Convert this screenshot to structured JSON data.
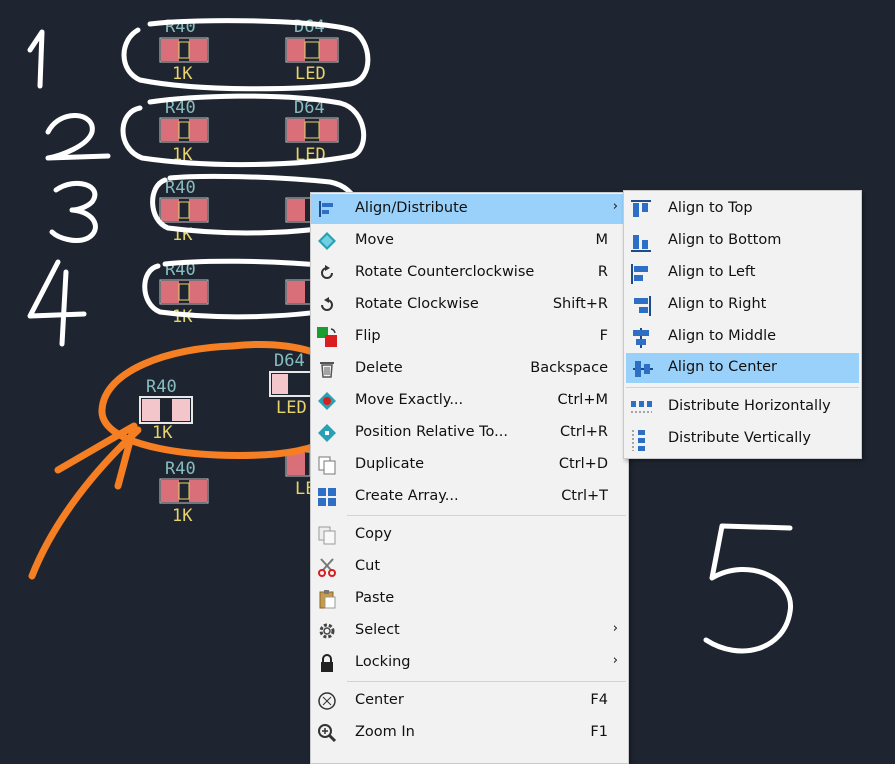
{
  "context_menu": {
    "items": [
      {
        "label": "Align/Distribute",
        "shortcut": "",
        "icon": "align-left-icon",
        "submenu": true
      },
      {
        "label": "Move",
        "shortcut": "M",
        "icon": "move-icon"
      },
      {
        "label": "Rotate Counterclockwise",
        "shortcut": "R",
        "icon": "rotate-ccw-icon"
      },
      {
        "label": "Rotate Clockwise",
        "shortcut": "Shift+R",
        "icon": "rotate-cw-icon"
      },
      {
        "label": "Flip",
        "shortcut": "F",
        "icon": "flip-icon"
      },
      {
        "label": "Delete",
        "shortcut": "Backspace",
        "icon": "trash-icon"
      },
      {
        "label": "Move Exactly...",
        "shortcut": "Ctrl+M",
        "icon": "move-exactly-icon"
      },
      {
        "label": "Position Relative To...",
        "shortcut": "Ctrl+R",
        "icon": "position-relative-icon"
      },
      {
        "label": "Duplicate",
        "shortcut": "Ctrl+D",
        "icon": "duplicate-icon"
      },
      {
        "label": "Create Array...",
        "shortcut": "Ctrl+T",
        "icon": "array-icon"
      },
      {
        "label": "Copy",
        "shortcut": "",
        "icon": "copy-icon"
      },
      {
        "label": "Cut",
        "shortcut": "",
        "icon": "scissors-icon"
      },
      {
        "label": "Paste",
        "shortcut": "",
        "icon": "paste-icon"
      },
      {
        "label": "Select",
        "shortcut": "",
        "icon": "gear-icon",
        "submenu": true
      },
      {
        "label": "Locking",
        "shortcut": "",
        "icon": "lock-icon",
        "submenu": true
      },
      {
        "label": "Center",
        "shortcut": "F4",
        "icon": "center-icon"
      },
      {
        "label": "Zoom In",
        "shortcut": "F1",
        "icon": "zoom-in-icon"
      }
    ],
    "submenu_arrow": "›"
  },
  "align_submenu": {
    "items": [
      {
        "label": "Align to Top",
        "icon": "align-top-icon"
      },
      {
        "label": "Align to Bottom",
        "icon": "align-bottom-icon"
      },
      {
        "label": "Align to Left",
        "icon": "align-left-icon"
      },
      {
        "label": "Align to Right",
        "icon": "align-right-icon"
      },
      {
        "label": "Align to Middle",
        "icon": "align-middle-icon"
      },
      {
        "label": "Align to Center",
        "icon": "align-center-icon",
        "highlighted": true
      },
      {
        "label": "Distribute Horizontally",
        "icon": "distribute-horizontal-icon"
      },
      {
        "label": "Distribute Vertically",
        "icon": "distribute-vertical-icon"
      }
    ]
  },
  "pcb": {
    "resistor_ref": "R40",
    "resistor_value": "1K",
    "led_ref": "D64",
    "led_value": "LED"
  },
  "annotations": [
    "1",
    "2",
    "3",
    "4",
    "5"
  ],
  "colors": {
    "background": "#1f2530",
    "pad": "#d96f79",
    "ref_text": "#86bdc0",
    "value_text": "#e8d36a",
    "highlight": "#99d1fb",
    "arrow": "#f57f22",
    "handwriting": "#ffffff"
  }
}
